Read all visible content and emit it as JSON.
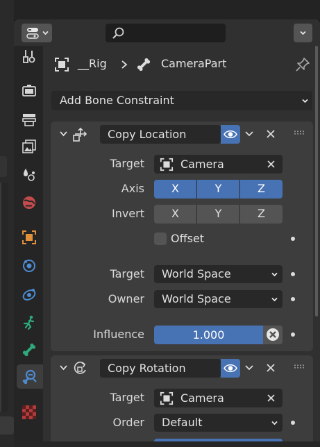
{
  "header": {
    "breadcrumb": {
      "object": "__Rig",
      "bone": "CameraPart"
    },
    "search": {
      "value": ""
    }
  },
  "add_constraint": {
    "label": "Add Bone Constraint"
  },
  "constraints": [
    {
      "name": "Copy Location",
      "target_label": "Target",
      "target_value": "Camera",
      "axis_label": "Axis",
      "axis": [
        "X",
        "Y",
        "Z"
      ],
      "invert_label": "Invert",
      "invert": [
        "X",
        "Y",
        "Z"
      ],
      "offset_label": "Offset",
      "target_space_label": "Target",
      "target_space": "World Space",
      "owner_space_label": "Owner",
      "owner_space": "World Space",
      "influence_label": "Influence",
      "influence": "1.000"
    },
    {
      "name": "Copy Rotation",
      "target_label": "Target",
      "target_value": "Camera",
      "order_label": "Order",
      "order_value": "Default"
    }
  ],
  "colors": {
    "accent": "#4772b3",
    "panel": "#303030",
    "field": "#282828",
    "button": "#545454",
    "tab_active": "#4d8bd0"
  }
}
